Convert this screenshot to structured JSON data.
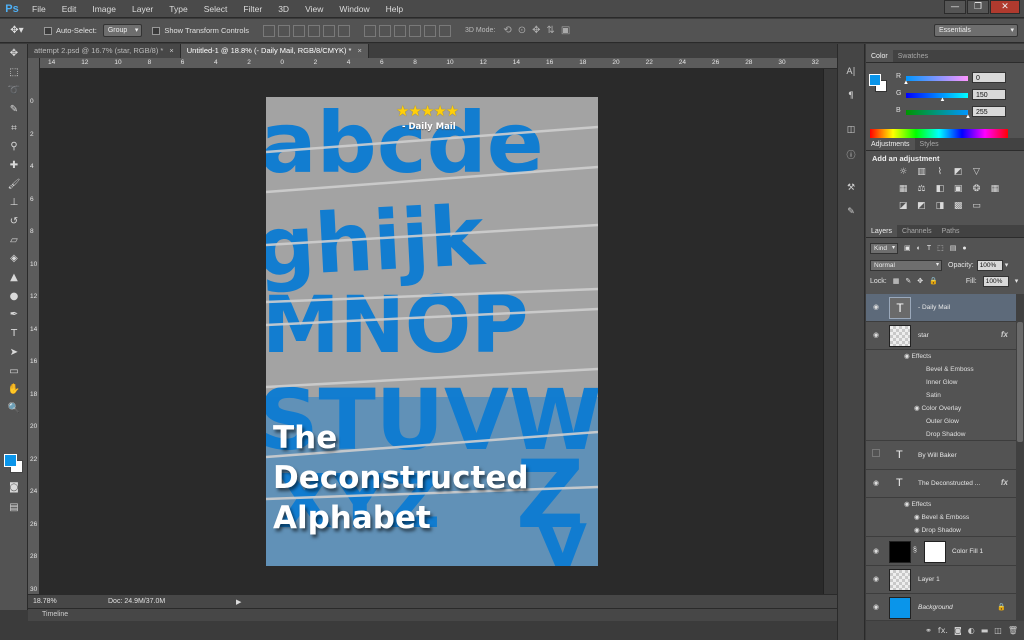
{
  "menubar": {
    "logo": "Ps",
    "items": [
      "File",
      "Edit",
      "Image",
      "Layer",
      "Type",
      "Select",
      "Filter",
      "3D",
      "View",
      "Window",
      "Help"
    ],
    "window_controls": [
      "—",
      "❐",
      "✕"
    ]
  },
  "options": {
    "auto_select_label": "Auto-Select:",
    "auto_select_value": "Group",
    "show_transform_label": "Show Transform Controls",
    "mode_3d_label": "3D Mode:",
    "workspace": "Essentials"
  },
  "tabs": [
    {
      "label": "attempt 2.psd @ 16.7% (star, RGB/8) *",
      "active": false
    },
    {
      "label": "Untitled-1 @ 18.8% (- Daily Mail, RGB/8/CMYK) *",
      "active": true
    }
  ],
  "ruler": {
    "h_labels": [
      "14",
      "12",
      "10",
      "8",
      "6",
      "4",
      "2",
      "0",
      "2",
      "4",
      "6",
      "8",
      "10",
      "12",
      "14",
      "16",
      "18",
      "20",
      "22",
      "24",
      "26",
      "28",
      "30",
      "32"
    ],
    "v_labels": [
      "0",
      "2",
      "4",
      "6",
      "8",
      "10",
      "12",
      "14",
      "16",
      "18",
      "20",
      "22",
      "24",
      "26",
      "28",
      "30"
    ]
  },
  "document": {
    "rating": "★★★★★",
    "source": "- Daily Mail",
    "title_lines": [
      "The",
      "Deconstructed",
      "Alphabet"
    ],
    "background_color": "#a3a3a3",
    "letter_color": "#127dd0",
    "rating_color": "#ffcf0a"
  },
  "status": {
    "zoom": "18.78%",
    "doc_info": "Doc: 24.9M/37.0M"
  },
  "timeline_label": "Timeline",
  "color_panel": {
    "tabs": [
      "Color",
      "Swatches"
    ],
    "channels": [
      {
        "name": "R",
        "value": "0",
        "fraction": 0.0
      },
      {
        "name": "G",
        "value": "150",
        "fraction": 0.588
      },
      {
        "name": "B",
        "value": "255",
        "fraction": 1.0
      }
    ],
    "foreground": "#0096ff"
  },
  "adjustments_panel": {
    "tabs": [
      "Adjustments",
      "Styles"
    ],
    "heading": "Add an adjustment"
  },
  "layers_panel": {
    "tabs": [
      "Layers",
      "Channels",
      "Paths"
    ],
    "kind_label": "Kind",
    "blend_mode": "Normal",
    "opacity_label": "Opacity:",
    "opacity_value": "100%",
    "lock_label": "Lock:",
    "fill_label": "Fill:",
    "fill_value": "100%",
    "layers": [
      {
        "name": "- Daily Mail",
        "type": "text",
        "visible": true,
        "selected": true
      },
      {
        "name": "star",
        "type": "pixel",
        "visible": true,
        "fx": "fx",
        "effects_label": "Effects",
        "effects": [
          "Bevel & Emboss",
          "Inner Glow",
          "Satin",
          "Color Overlay",
          "Outer Glow",
          "Drop Shadow"
        ]
      },
      {
        "name": "By Will Baker",
        "type": "text",
        "visible": false
      },
      {
        "name": "The Deconstructed ...",
        "type": "text",
        "visible": true,
        "fx": "fx",
        "effects_label": "Effects",
        "effects": [
          "Bevel & Emboss",
          "Drop Shadow"
        ]
      },
      {
        "name": "Color Fill 1",
        "type": "fill",
        "visible": true
      },
      {
        "name": "Layer 1",
        "type": "pixel",
        "visible": true
      },
      {
        "name": "Background",
        "type": "background",
        "visible": true
      }
    ]
  }
}
